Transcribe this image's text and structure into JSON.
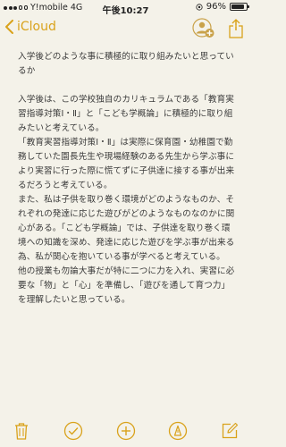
{
  "status": {
    "carrier": "Y!mobile",
    "network": "4G",
    "time": "午後10:27",
    "battery_percent_label": "96%",
    "battery_level": 0.96
  },
  "nav": {
    "back_label": "iCloud"
  },
  "note": {
    "paragraphs": [
      "入学後どのような事に積極的に取り組みたいと思っているか",
      "",
      "入学後は、この学校独自のカリキュラムである「教育実習指導対策Ⅰ・Ⅱ」と「こども学概論」に積極的に取り組みたいと考えている。",
      "「教育実習指導対策Ⅰ・Ⅱ」は実際に保育園・幼稚園で勤務していた園長先生や現場経験のある先生から学ぶ事により実習に行った際に慌てずに子供達に接する事が出来るだろうと考えている。",
      "また、私は子供を取り巻く環境がどのようなものか、それぞれの発達に応じた遊びがどのようなものなのかに関心がある。「こども学概論」では、子供達を取り巻く環境への知識を深め、発達に応じた遊びを学ぶ事が出来る為、私が関心を抱いている事が学べると考えている。",
      "他の授業も勿論大事だが特に二つに力を入れ、実習に必要な「物」と「心」を準備し、「遊びを通して育つ力」を理解したいと思っている。"
    ]
  },
  "colors": {
    "accent": "#d9a21b",
    "background": "#f4f2e9"
  }
}
